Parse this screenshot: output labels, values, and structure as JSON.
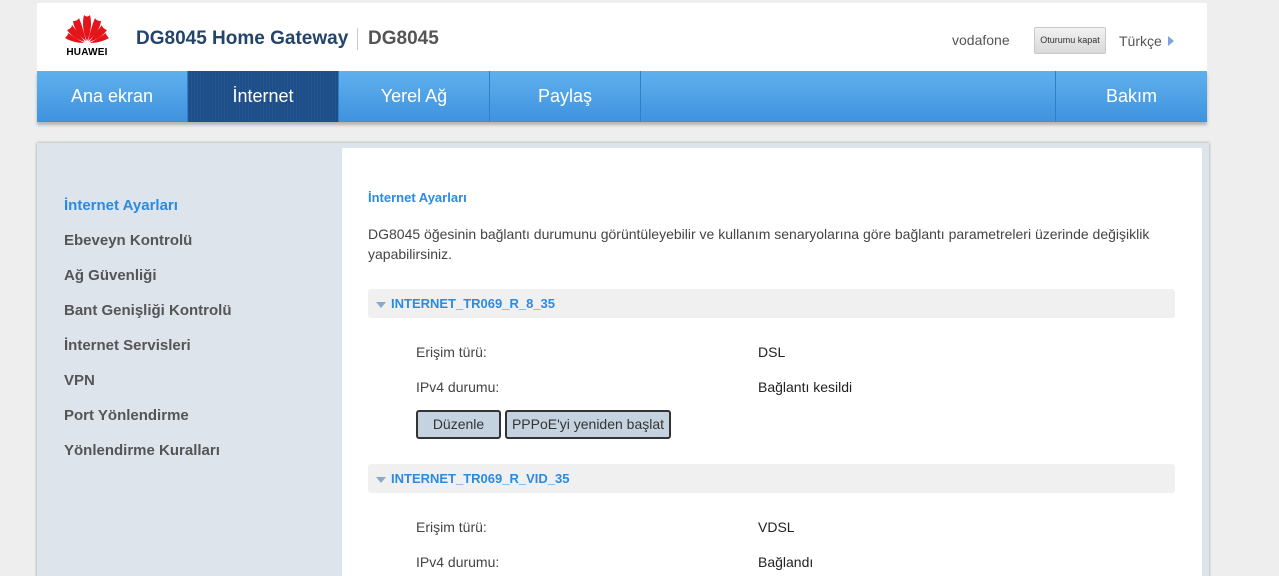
{
  "header": {
    "logo_text": "HUAWEI",
    "product_title": "DG8045 Home Gateway",
    "model": "DG8045",
    "isp": "vodafone",
    "logout_label": "Oturumu kapat",
    "language": "Türkçe"
  },
  "nav": {
    "items": [
      {
        "label": "Ana ekran"
      },
      {
        "label": "İnternet",
        "active": true
      },
      {
        "label": "Yerel Ağ"
      },
      {
        "label": "Paylaş"
      },
      {
        "label": "Bakım"
      }
    ]
  },
  "sidebar": {
    "items": [
      {
        "label": "İnternet Ayarları",
        "active": true
      },
      {
        "label": "Ebeveyn Kontrolü"
      },
      {
        "label": "Ağ Güvenliği"
      },
      {
        "label": "Bant Genişliği Kontrolü"
      },
      {
        "label": "İnternet Servisleri"
      },
      {
        "label": "VPN"
      },
      {
        "label": "Port Yönlendirme"
      },
      {
        "label": "Yönlendirme Kuralları"
      }
    ]
  },
  "content": {
    "title": "İnternet Ayarları",
    "description": "DG8045 öğesinin bağlantı durumunu görüntüleyebilir ve kullanım senaryolarına göre bağlantı parametreleri üzerinde değişiklik yapabilirsiniz.",
    "connections": [
      {
        "name": "INTERNET_TR069_R_8_35",
        "access_label": "Erişim türü:",
        "access_value": "DSL",
        "ipv4_label": "IPv4 durumu:",
        "ipv4_value": "Bağlantı kesildi",
        "edit_label": "Düzenle",
        "restart_label": "PPPoE'yi yeniden başlat"
      },
      {
        "name": "INTERNET_TR069_R_VID_35",
        "access_label": "Erişim türü:",
        "access_value": "VDSL",
        "ipv4_label": "IPv4 durumu:",
        "ipv4_value": "Bağlandı"
      }
    ]
  },
  "colors": {
    "accent": "#2a8be0",
    "nav_bg": "#4ba2e6",
    "nav_active": "#1d4e8a",
    "title": "#23456b"
  }
}
